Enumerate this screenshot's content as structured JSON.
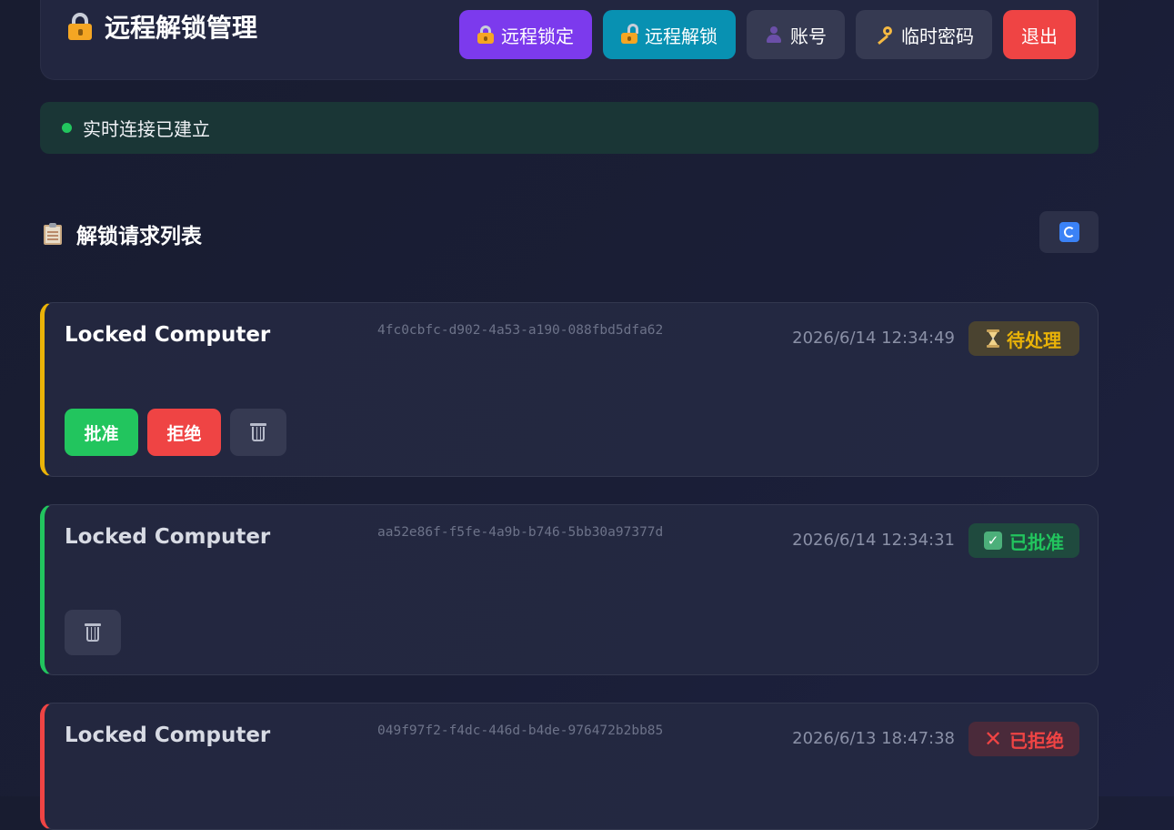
{
  "header": {
    "title": "远程解锁管理",
    "buttons": {
      "lock": "远程锁定",
      "unlock": "远程解锁",
      "account": "账号",
      "temp_password": "临时密码",
      "logout": "退出"
    }
  },
  "connection": {
    "text": "实时连接已建立",
    "color": "#22c55e"
  },
  "section": {
    "title": "解锁请求列表"
  },
  "requests": [
    {
      "name": "Locked Computer",
      "id": "4fc0cbfc-d902-4a53-a190-088fbd5dfa62",
      "time": "2026/6/14 12:34:49",
      "status": "待处理",
      "status_color": "#eab308",
      "actions": {
        "approve": "批准",
        "reject": "拒绝"
      }
    },
    {
      "name": "Locked Computer",
      "id": "aa52e86f-f5fe-4a9b-b746-5bb30a97377d",
      "time": "2026/6/14 12:34:31",
      "status": "已批准",
      "status_color": "#22c55e"
    },
    {
      "name": "Locked Computer",
      "id": "049f97f2-f4dc-446d-b4de-976472b2bb85",
      "time": "2026/6/13 18:47:38",
      "status": "已拒绝",
      "status_color": "#ef4444"
    }
  ],
  "colors": {
    "lock_button": "#7c3aed",
    "unlock_button": "#0891b2",
    "logout_button": "#ef4444",
    "approve_button": "#22c55e",
    "reject_button": "#ef4444"
  }
}
